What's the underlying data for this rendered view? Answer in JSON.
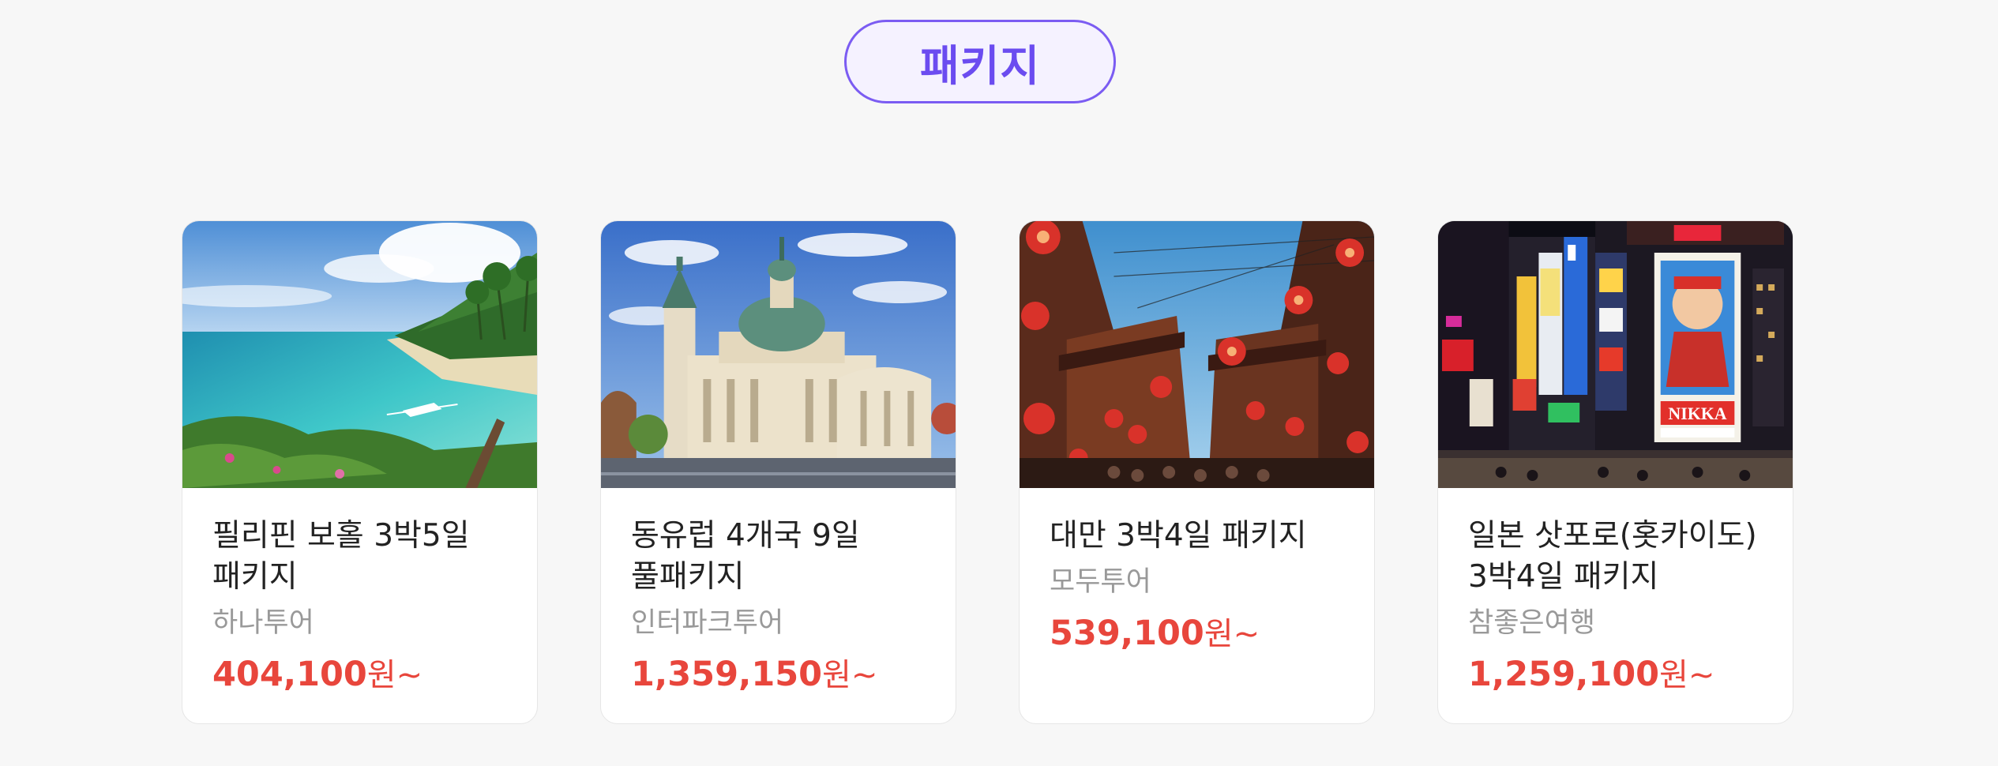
{
  "section": {
    "title": "패키지"
  },
  "colors": {
    "accent": "#7b5cf2",
    "price": "#e8463c",
    "agency": "#999999",
    "background": "#f7f7f7"
  },
  "cards": [
    {
      "title": "필리핀 보홀 3박5일 패키지",
      "agency": "하나투어",
      "price": "404,100",
      "price_suffix": "원~",
      "image": "tropical-beach-photo"
    },
    {
      "title": "동유럽 4개국 9일 풀패키지",
      "agency": "인터파크투어",
      "price": "1,359,150",
      "price_suffix": "원~",
      "image": "basilica-photo"
    },
    {
      "title": "대만 3박4일 패키지",
      "agency": "모두투어",
      "price": "539,100",
      "price_suffix": "원~",
      "image": "lantern-street-photo"
    },
    {
      "title": "일본 삿포로(홋카이도) 3박4일 패키지",
      "agency": "참좋은여행",
      "price": "1,259,100",
      "price_suffix": "원~",
      "image": "neon-city-night-photo"
    }
  ]
}
